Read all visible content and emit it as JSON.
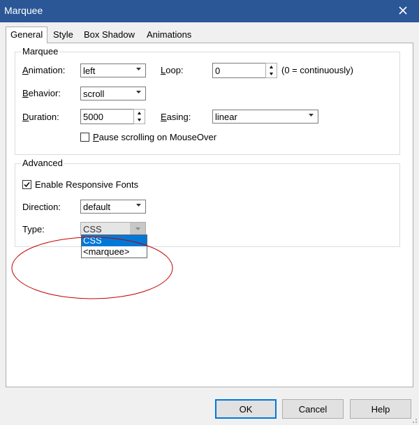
{
  "window": {
    "title": "Marquee"
  },
  "tabs": [
    {
      "label": "General"
    },
    {
      "label": "Style"
    },
    {
      "label": "Box Shadow"
    },
    {
      "label": "Animations"
    }
  ],
  "marquee_group": {
    "title": "Marquee",
    "animation": {
      "label_u": "A",
      "label_rest": "nimation:",
      "value": "left"
    },
    "loop": {
      "label_u": "L",
      "label_rest": "oop:",
      "value": "0",
      "hint": "(0 = continuously)"
    },
    "behavior": {
      "label_u": "B",
      "label_rest": "ehavior:",
      "value": "scroll"
    },
    "duration": {
      "label_u": "D",
      "label_rest": "uration:",
      "value": "5000"
    },
    "easing": {
      "label_u": "E",
      "label_rest": "asing:",
      "value": "linear"
    },
    "pause": {
      "label_u": "P",
      "label_rest": "ause scrolling on MouseOver",
      "checked": false
    }
  },
  "advanced_group": {
    "title": "Advanced",
    "responsive_fonts": {
      "label": "Enable Responsive Fonts",
      "checked": true
    },
    "direction": {
      "label": "Direction:",
      "value": "default"
    },
    "type": {
      "label": "Type:",
      "value": "CSS",
      "options": [
        "CSS",
        "<marquee>"
      ]
    }
  },
  "buttons": {
    "ok": "OK",
    "cancel": "Cancel",
    "help": "Help"
  },
  "colors": {
    "titlebar": "#2b5797",
    "selection": "#0078d7",
    "annotation": "#c00000"
  }
}
